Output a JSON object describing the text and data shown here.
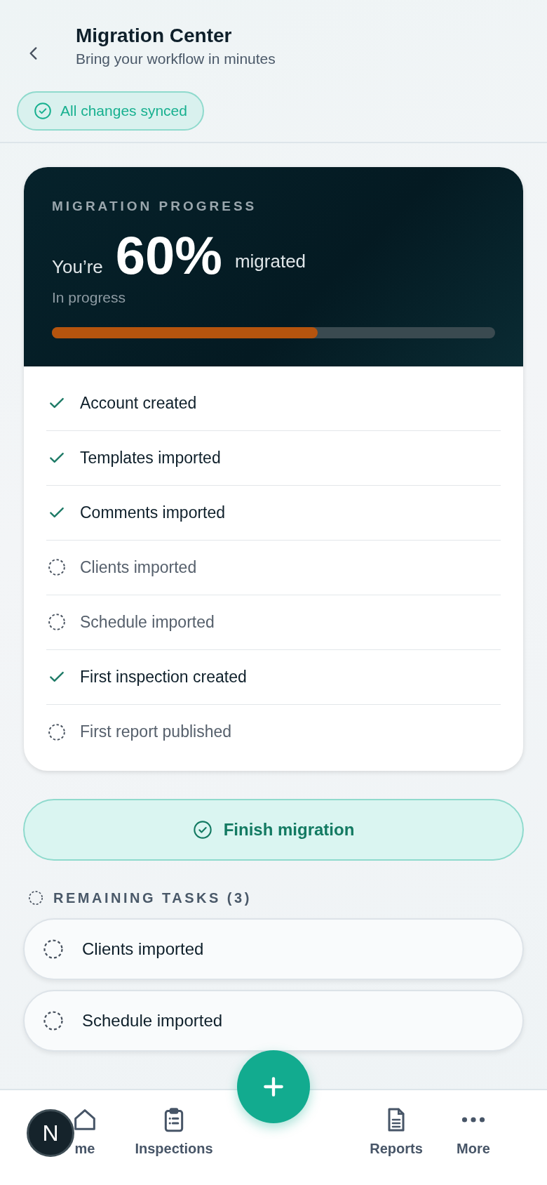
{
  "header": {
    "title": "Migration Center",
    "subtitle": "Bring your workflow in minutes",
    "sync_status": "All changes synced"
  },
  "progress": {
    "eyebrow": "MIGRATION PROGRESS",
    "prefix": "You’re",
    "percent": "60%",
    "suffix": "migrated",
    "status": "In progress",
    "level": 0.6
  },
  "checklist": [
    {
      "label": "Account created",
      "done": true
    },
    {
      "label": "Templates imported",
      "done": true
    },
    {
      "label": "Comments imported",
      "done": true
    },
    {
      "label": "Clients imported",
      "done": false
    },
    {
      "label": "Schedule imported",
      "done": false
    },
    {
      "label": "First inspection created",
      "done": true
    },
    {
      "label": "First report published",
      "done": false
    }
  ],
  "finish_button": "Finish migration",
  "remaining": {
    "heading": "REMAINING TASKS (3)",
    "tasks": [
      {
        "label": "Clients imported"
      },
      {
        "label": "Schedule imported"
      }
    ]
  },
  "nav": [
    {
      "label": "me",
      "kind": "tab",
      "selected": false
    },
    {
      "label": "Inspections",
      "kind": "tab",
      "selected": false
    },
    {
      "kind": "fab"
    },
    {
      "label": "Reports",
      "kind": "tab",
      "selected": false
    },
    {
      "label": "More",
      "kind": "tab",
      "selected": false
    }
  ],
  "dev_badge": "N"
}
